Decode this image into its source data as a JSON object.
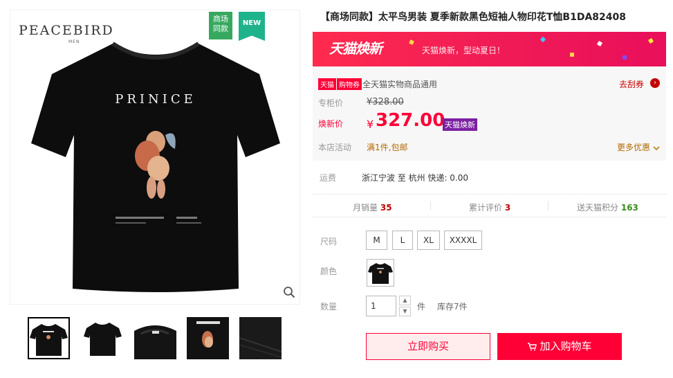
{
  "gallery": {
    "brand": "PEACEBIRD",
    "brand_sub": "MEN",
    "tag_mall_line1": "商场",
    "tag_mall_line2": "同款",
    "tag_new": "NEW",
    "print_text": "PRINICE",
    "zoom_icon": "search-icon",
    "thumbnails": [
      "thumb-1",
      "thumb-2",
      "thumb-3",
      "thumb-4",
      "thumb-5"
    ]
  },
  "product": {
    "title": "【商场同款】太平鸟男装 夏季新款黑色短袖人物印花T恤B1DA82408"
  },
  "promo_banner": {
    "logo": "天猫焕新",
    "slogan": "天猫焕新，型动夏日！"
  },
  "pricing": {
    "coupon_badge1": "天猫",
    "coupon_badge2": "购物券",
    "coupon_text": "全天猫实物商品通用",
    "coupon_link": "去刮券",
    "coupon_arrow": "›",
    "orig_label": "专柜价",
    "orig_price": "¥328.00",
    "sale_label": "焕新价",
    "sale_currency": "¥",
    "sale_price": "327.00",
    "sale_badge": "天猫焕新",
    "promo_label": "本店活动",
    "promo_value": "满1件,包邮",
    "more_promo": "更多优惠"
  },
  "shipping": {
    "label": "运费",
    "value": "浙江宁波 至 杭州  快递: 0.00"
  },
  "stats": {
    "monthly_sales_label": "月销量",
    "monthly_sales_value": "35",
    "reviews_label": "累计评价",
    "reviews_value": "3",
    "points_label": "送天猫积分",
    "points_value": "163"
  },
  "options": {
    "size_label": "尺码",
    "sizes": [
      "M",
      "L",
      "XL",
      "XXXXL"
    ],
    "color_label": "颜色",
    "qty_label": "数量",
    "qty_value": "1",
    "qty_unit": "件",
    "stock": "库存7件"
  },
  "actions": {
    "buy_now": "立即购买",
    "add_cart": "加入购物车"
  },
  "colors": {
    "brand_red": "#ff0036",
    "promo_pink": "#f21d55",
    "badge_purple": "#7b1fa2",
    "tag_green": "#37a860",
    "tag_new": "#1fb38c"
  }
}
